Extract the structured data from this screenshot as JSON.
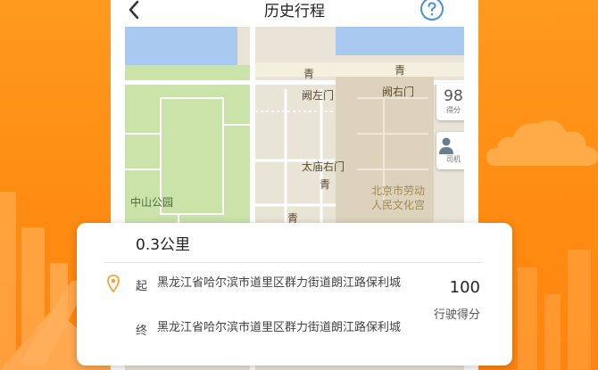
{
  "header": {
    "title": "历史行程",
    "back_icon": "chevron-left-icon",
    "help_icon": "question-circle-icon"
  },
  "map": {
    "labels": {
      "que_zuo_men": "阙左门",
      "que_you_men": "阙右门",
      "tai_miao_you_men": "太庙右门",
      "zhongshan_park": "中山公园",
      "workers_palace": "北京市劳动\n人民文化宫",
      "poi_glyph": "青"
    },
    "score_button": {
      "value": "98",
      "label": "得分"
    },
    "driver_button": {
      "label": "司机"
    }
  },
  "trip": {
    "distance": "0.3公里",
    "start_tag": "起",
    "end_tag": "终",
    "start_address": "黑龙江省哈尔滨市道里区群力街道朗江路保利城",
    "end_address": "黑龙江省哈尔滨市道里区群力街道朗江路保利城",
    "score_value": "100",
    "score_label": "行驶得分"
  },
  "colors": {
    "accent": "#ff8c12",
    "water": "#a8c8ef",
    "park": "#c9e3a8",
    "road": "#ffffff"
  }
}
